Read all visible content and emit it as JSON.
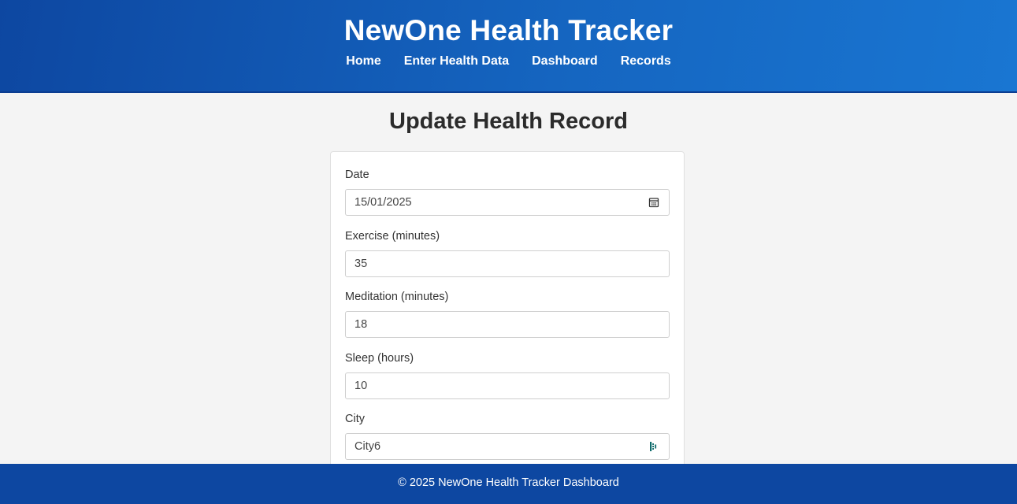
{
  "header": {
    "title": "NewOne Health Tracker",
    "nav": [
      {
        "label": "Home"
      },
      {
        "label": "Enter Health Data"
      },
      {
        "label": "Dashboard"
      },
      {
        "label": "Records"
      }
    ]
  },
  "main": {
    "title": "Update Health Record",
    "form": {
      "date": {
        "label": "Date",
        "value": "15/01/2025",
        "icon": "calendar-icon"
      },
      "exercise": {
        "label": "Exercise (minutes)",
        "value": "35"
      },
      "meditation": {
        "label": "Meditation (minutes)",
        "value": "18"
      },
      "sleep": {
        "label": "Sleep (hours)",
        "value": "10"
      },
      "city": {
        "label": "City",
        "value": "City6",
        "icon": "autofill-icon"
      }
    }
  },
  "footer": {
    "text": "© 2025 NewOne Health Tracker Dashboard"
  },
  "colors": {
    "header_bg": "#1565c0",
    "footer_bg": "#0d47a1",
    "page_bg": "#f4f4f4",
    "autofill_icon": "#0f6b6b"
  }
}
